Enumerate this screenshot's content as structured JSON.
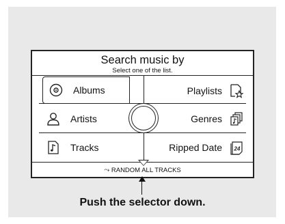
{
  "screen": {
    "title": "Search music by",
    "subtitle": "Select one of the list.",
    "items_left": [
      {
        "label": "Albums",
        "icon": "disc-icon",
        "selected": true
      },
      {
        "label": "Artists",
        "icon": "person-icon",
        "selected": false
      },
      {
        "label": "Tracks",
        "icon": "music-note-icon",
        "selected": false
      }
    ],
    "items_right": [
      {
        "label": "Playlists",
        "icon": "playlist-star-icon"
      },
      {
        "label": "Genres",
        "icon": "genres-icon"
      },
      {
        "label": "Ripped Date",
        "icon": "calendar-icon",
        "badge": "24"
      }
    ],
    "bottom_action": "RANDOM ALL TRACKS"
  },
  "caption": "Push the selector down."
}
